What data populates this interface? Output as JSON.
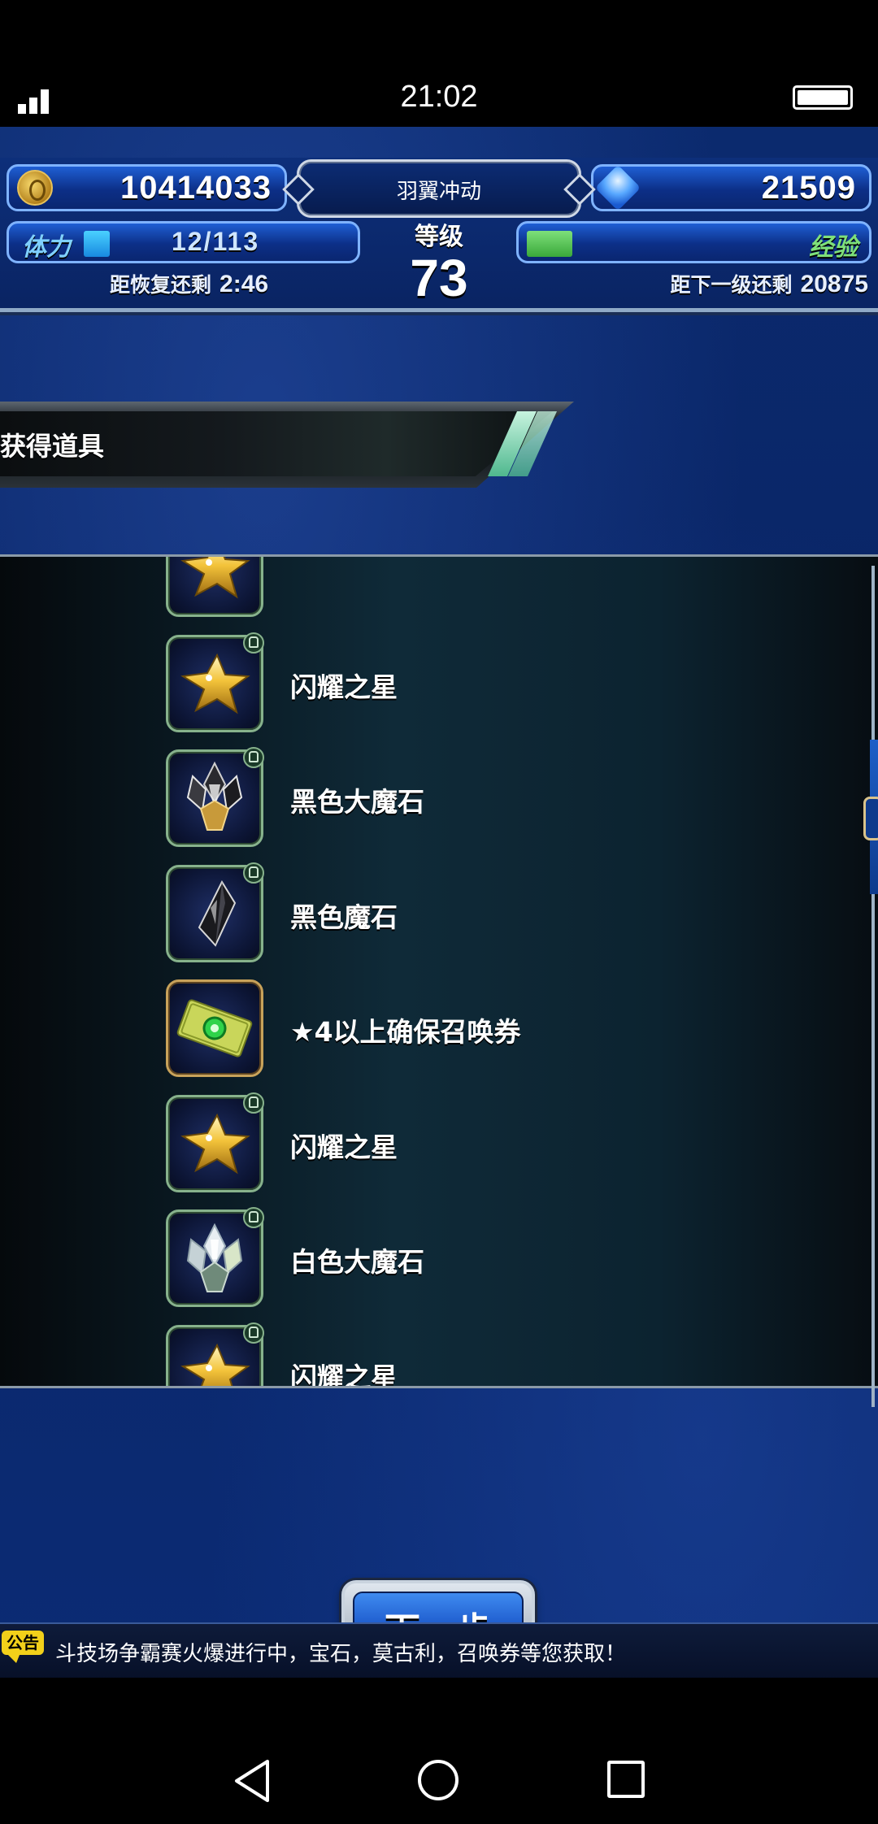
{
  "status_bar": {
    "time": "21:02"
  },
  "header": {
    "gil": "10414033",
    "gems": "21509",
    "player_name": "羽翼冲动",
    "level_label": "等级",
    "level": "73",
    "stamina_label": "体力",
    "stamina": "12/113",
    "stamina_fill": 0.106,
    "recover_label": "距恢复还剩",
    "recover_time": "2:46",
    "exp_label": "经验",
    "next_level_label": "距下一级还剩",
    "next_level_exp": "20875"
  },
  "section": {
    "title": "获得道具"
  },
  "items": [
    {
      "name": "",
      "icon": "star-icon",
      "frame": "green"
    },
    {
      "name": "闪耀之星",
      "icon": "star-icon",
      "frame": "green"
    },
    {
      "name": "黑色大魔石",
      "icon": "black-crystal-cluster-icon",
      "frame": "green"
    },
    {
      "name": "黑色魔石",
      "icon": "black-crystal-icon",
      "frame": "green"
    },
    {
      "name": "★4以上确保召唤券",
      "icon": "summon-ticket-icon",
      "frame": "gold"
    },
    {
      "name": "闪耀之星",
      "icon": "star-icon",
      "frame": "green"
    },
    {
      "name": "白色大魔石",
      "icon": "white-crystal-cluster-icon",
      "frame": "green"
    },
    {
      "name": "闪耀之星",
      "icon": "star-icon",
      "frame": "green"
    }
  ],
  "actions": {
    "next_label": "下一步"
  },
  "ticker": {
    "badge": "公告",
    "text": "斗技场争霸赛火爆进行中，宝石，莫古利，召唤券等您获取！"
  },
  "colors": {
    "frame_green": "#87b28c",
    "frame_gold": "#c8a25a",
    "stamina": "#1889e0",
    "exp": "#3aa83a",
    "ticker_badge": "#f2d01a"
  }
}
